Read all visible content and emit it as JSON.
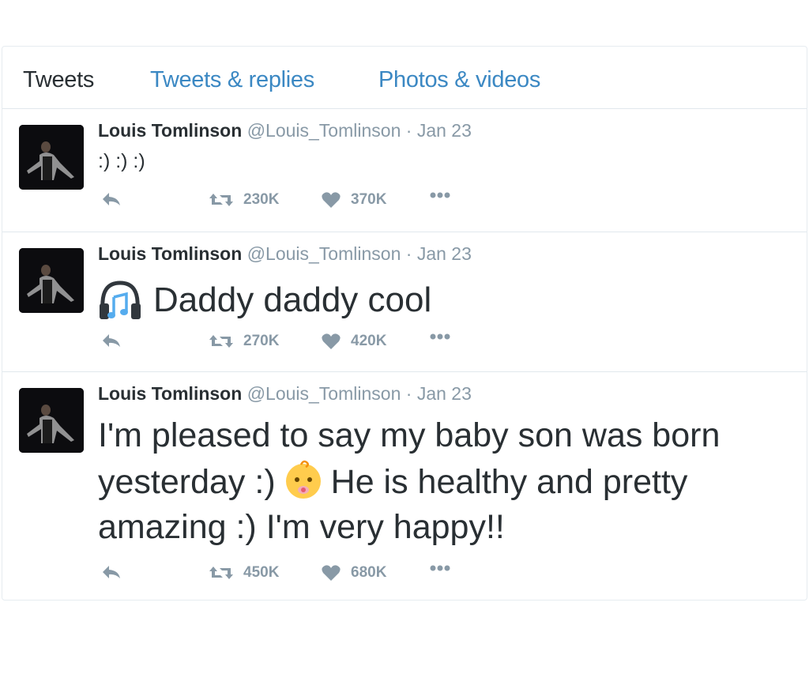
{
  "tabs": [
    "Tweets",
    "Tweets & replies",
    "Photos & videos"
  ],
  "colors": {
    "link": "#3b88c3",
    "text": "#292f33",
    "muted": "#8899a6",
    "border": "#e1e8ed"
  },
  "tweets": [
    {
      "name": "Louis Tomlinson",
      "handle": "@Louis_Tomlinson",
      "separator": "·",
      "date": "Jan 23",
      "text": ":) :) :)",
      "retweets": "230K",
      "likes": "370K"
    },
    {
      "name": "Louis Tomlinson",
      "handle": "@Louis_Tomlinson",
      "separator": "·",
      "date": "Jan 23",
      "emoji": "headphones-emoji",
      "text": "Daddy daddy cool",
      "retweets": "270K",
      "likes": "420K"
    },
    {
      "name": "Louis Tomlinson",
      "handle": "@Louis_Tomlinson",
      "separator": "·",
      "date": "Jan 23",
      "text_before": "I'm pleased to say my baby son was born yesterday :)",
      "emoji": "baby-emoji",
      "text_after": "He is healthy and pretty amazing :) I'm very happy!!",
      "retweets": "450K",
      "likes": "680K"
    }
  ],
  "icons": {
    "reply": "reply-icon",
    "retweet": "retweet-icon",
    "like": "heart-icon",
    "more": "more-icon"
  }
}
